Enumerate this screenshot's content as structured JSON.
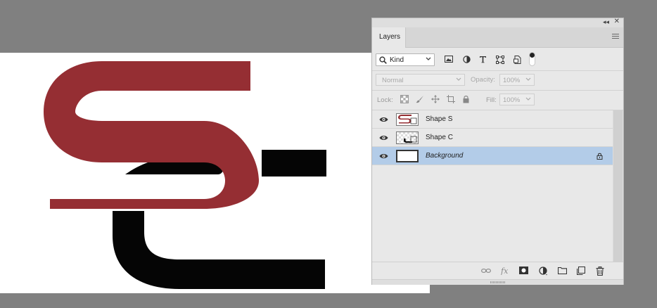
{
  "panel": {
    "tab_label": "Layers",
    "filter": {
      "kind_label": "Kind"
    },
    "blend_mode": "Normal",
    "opacity_label": "Opacity:",
    "opacity_value": "100%",
    "lock_label": "Lock:",
    "fill_label": "Fill:",
    "fill_value": "100%"
  },
  "layers": [
    {
      "name": "Shape S",
      "visible": true,
      "selected": false,
      "locked": false
    },
    {
      "name": "Shape C",
      "visible": true,
      "selected": false,
      "locked": false
    },
    {
      "name": "Background",
      "visible": true,
      "selected": true,
      "locked": true
    }
  ],
  "colors": {
    "workspace": "#808080",
    "canvas": "#ffffff",
    "shape_s": "#952e33",
    "shape_c": "#050505",
    "selected_layer": "#b3cce8"
  },
  "icons": {
    "filter": [
      "image-filter-icon",
      "adjustment-filter-icon",
      "type-filter-icon",
      "shape-filter-icon",
      "smart-object-filter-icon",
      "filter-toggle-icon"
    ],
    "lock": [
      "lock-transparent-pixels-icon",
      "lock-image-pixels-icon",
      "lock-position-icon",
      "lock-artboard-icon",
      "lock-all-icon"
    ],
    "footer": [
      "link-layers-icon",
      "fx-icon",
      "add-mask-icon",
      "adjustment-layer-icon",
      "new-group-icon",
      "new-layer-icon",
      "delete-layer-icon"
    ]
  }
}
